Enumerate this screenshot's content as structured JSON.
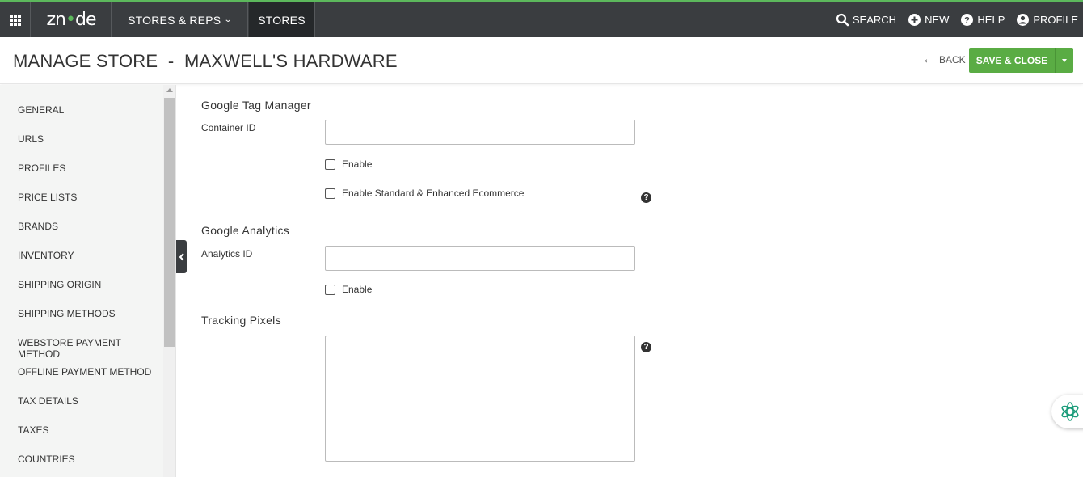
{
  "topbar": {
    "logo": {
      "before": "zn",
      "dot": "•",
      "after": "de",
      "full": "znode"
    },
    "nav": [
      {
        "label": "STORES & REPS",
        "icon": "chevron-down-icon"
      },
      {
        "label": "STORES"
      }
    ],
    "tools": [
      {
        "label": "SEARCH",
        "icon": "search-icon"
      },
      {
        "label": "NEW",
        "icon": "plus-circle-icon"
      },
      {
        "label": "HELP",
        "icon": "question-circle-icon"
      },
      {
        "label": "PROFILE",
        "icon": "user-circle-icon"
      }
    ],
    "accent": "#5cb85c"
  },
  "header": {
    "title": "MANAGE STORE  -  MAXWELL'S HARDWARE",
    "back_label": "BACK",
    "save_label": "SAVE & CLOSE",
    "save_color": "#5aac44"
  },
  "sidebar": {
    "items": [
      {
        "label": "GENERAL"
      },
      {
        "label": "URLS"
      },
      {
        "label": "PROFILES"
      },
      {
        "label": "PRICE LISTS"
      },
      {
        "label": "BRANDS"
      },
      {
        "label": "INVENTORY"
      },
      {
        "label": "SHIPPING ORIGIN"
      },
      {
        "label": "SHIPPING METHODS"
      },
      {
        "label": "WEBSTORE PAYMENT METHOD"
      },
      {
        "label": "OFFLINE PAYMENT METHOD"
      },
      {
        "label": "TAX DETAILS"
      },
      {
        "label": "TAXES"
      },
      {
        "label": "COUNTRIES"
      }
    ]
  },
  "form": {
    "gtm": {
      "title": "Google Tag Manager",
      "container_label": "Container ID",
      "container_value": "",
      "enable_label": "Enable",
      "enable_checked": false,
      "ecommerce_label": "Enable Standard & Enhanced Ecommerce",
      "ecommerce_checked": false
    },
    "ga": {
      "title": "Google Analytics",
      "analytics_label": "Analytics ID",
      "analytics_value": "",
      "enable_label": "Enable",
      "enable_checked": false
    },
    "tracking": {
      "title": "Tracking Pixels",
      "value": ""
    },
    "help_glyph": "?"
  }
}
